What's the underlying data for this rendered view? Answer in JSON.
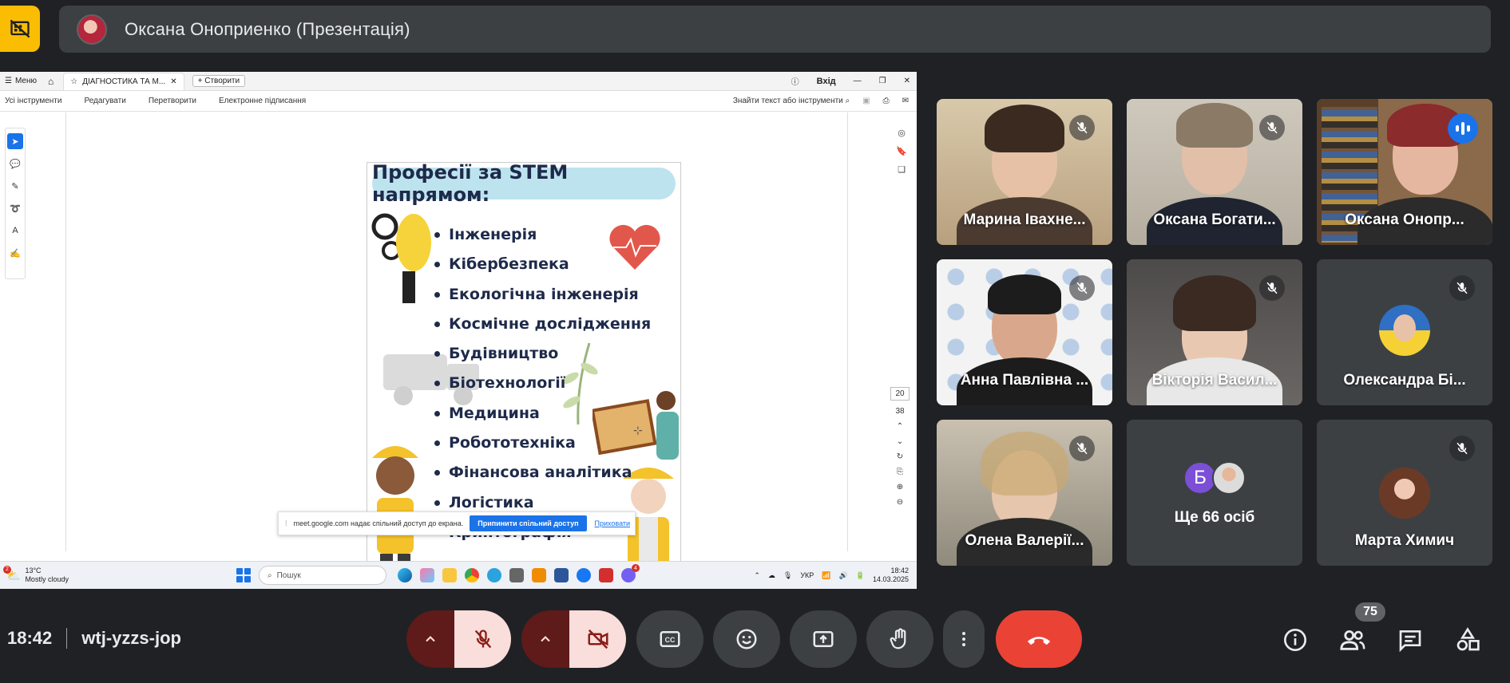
{
  "presenter": {
    "name": "Оксана Оноприенко (Презентація)"
  },
  "shared_window": {
    "menu_label": "Меню",
    "tab_title": "ДІАГНОСТИКА ТА М...",
    "create_label": "Створити",
    "login_label": "Вхід",
    "toolbar": {
      "all_tools": "Усі інструменти",
      "edit": "Редагувати",
      "convert": "Перетворити",
      "sign": "Електронне підписання",
      "search_placeholder": "Знайти текст або інструменти"
    },
    "document": {
      "heading": "Професії за STEM напрямом:",
      "professions": [
        "Інженерія",
        "Кібербезпека",
        "Екологічна інженерія",
        "Космічне дослідження",
        "Будівництво",
        "Біотехнології",
        "Медицина",
        "Робототехніка",
        "Фінансова аналітика",
        "Логістика",
        "Криптографія"
      ]
    },
    "page_nav": {
      "current_page": "20",
      "total_pages": "38"
    },
    "share_notice": {
      "text": "meet.google.com надає спільний доступ до екрана.",
      "stop_button": "Припинити спільний доступ",
      "hide_link": "Приховати"
    },
    "taskbar": {
      "weather_temp": "13°C",
      "weather_desc": "Mostly cloudy",
      "weather_badge": "2",
      "search_placeholder": "Пошук",
      "language": "УКР",
      "clock_time": "18:42",
      "clock_date": "14.03.2025",
      "app_badge": "4"
    }
  },
  "participants": [
    {
      "name": "Марина Івахне...",
      "muted": true
    },
    {
      "name": "Оксана Богати...",
      "muted": true
    },
    {
      "name": "Оксана Онопр...",
      "speaking": true
    },
    {
      "name": "Анна Павлівна ...",
      "muted": true
    },
    {
      "name": "Вікторія Васил...",
      "muted": true
    },
    {
      "name": "Олександра Бі...",
      "muted": true
    },
    {
      "name": "Олена Валерії...",
      "muted": true
    },
    {
      "name": "Ще 66 осіб",
      "avatar_letter": "Б"
    },
    {
      "name": "Марта Химич",
      "muted": true
    }
  ],
  "bottom_bar": {
    "time": "18:42",
    "meeting_code": "wtj-yzzs-jop",
    "participant_count": "75"
  },
  "colors": {
    "background": "#202124",
    "tile": "#3c4043",
    "stop_share": "#fbbc04",
    "end_call": "#ea4335",
    "active_outline": "#8ab4f8",
    "speaking_badge": "#1a73e8"
  }
}
